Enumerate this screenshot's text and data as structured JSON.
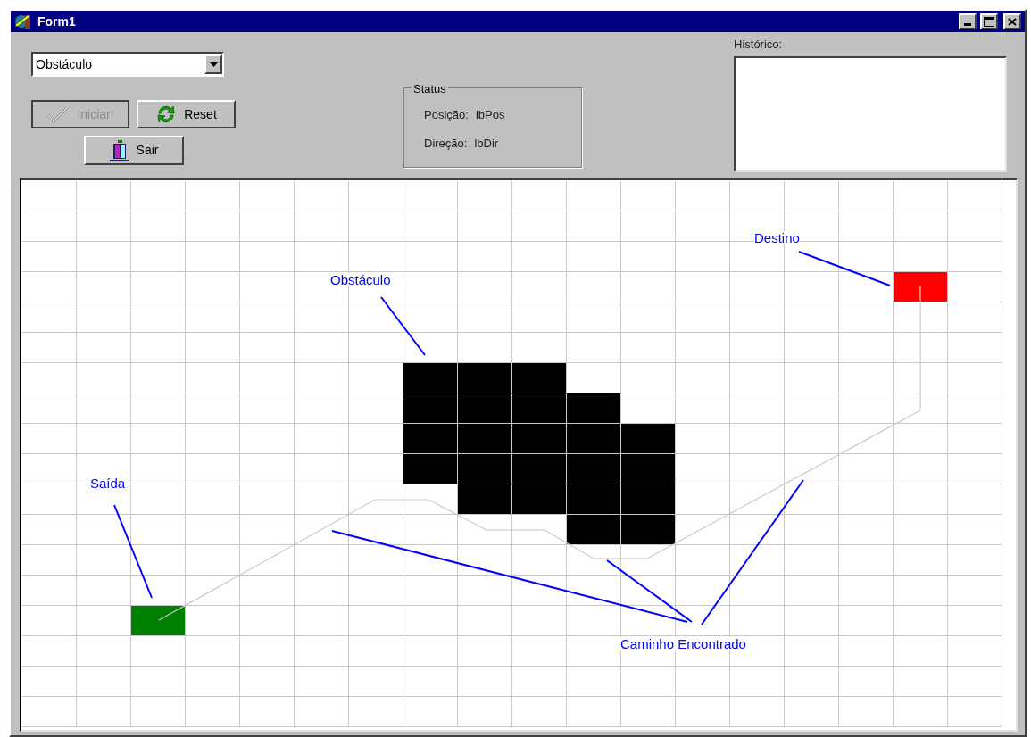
{
  "window": {
    "title": "Form1"
  },
  "mode_select": {
    "value": "Obstáculo"
  },
  "buttons": [
    {
      "label": "Iniciar!",
      "kind": "start",
      "disabled": true
    },
    {
      "label": "Reset",
      "kind": "reset",
      "disabled": false
    },
    {
      "label": "Sair",
      "kind": "exit",
      "disabled": false
    }
  ],
  "status": {
    "title": "Status",
    "rows": [
      {
        "label": "Posição:",
        "value": "lbPos"
      },
      {
        "label": "Direção:",
        "value": "lbDir"
      }
    ]
  },
  "history": {
    "label": "Histórico:"
  },
  "grid": {
    "rows": [
      {
        "cells": [
          {
            "kind": "empty"
          },
          {
            "kind": "empty"
          },
          {
            "kind": "empty"
          },
          {
            "kind": "empty"
          },
          {
            "kind": "empty"
          },
          {
            "kind": "empty"
          },
          {
            "kind": "empty"
          },
          {
            "kind": "empty"
          },
          {
            "kind": "empty"
          },
          {
            "kind": "empty"
          },
          {
            "kind": "empty"
          },
          {
            "kind": "empty"
          },
          {
            "kind": "empty"
          },
          {
            "kind": "empty"
          },
          {
            "kind": "empty"
          },
          {
            "kind": "empty"
          },
          {
            "kind": "empty"
          },
          {
            "kind": "empty"
          }
        ]
      },
      {
        "cells": [
          {
            "kind": "empty"
          },
          {
            "kind": "empty"
          },
          {
            "kind": "empty"
          },
          {
            "kind": "empty"
          },
          {
            "kind": "empty"
          },
          {
            "kind": "empty"
          },
          {
            "kind": "empty"
          },
          {
            "kind": "empty"
          },
          {
            "kind": "empty"
          },
          {
            "kind": "empty"
          },
          {
            "kind": "empty"
          },
          {
            "kind": "empty"
          },
          {
            "kind": "empty"
          },
          {
            "kind": "empty"
          },
          {
            "kind": "empty"
          },
          {
            "kind": "empty"
          },
          {
            "kind": "empty"
          },
          {
            "kind": "empty"
          }
        ]
      },
      {
        "cells": [
          {
            "kind": "empty"
          },
          {
            "kind": "empty"
          },
          {
            "kind": "empty"
          },
          {
            "kind": "empty"
          },
          {
            "kind": "empty"
          },
          {
            "kind": "empty"
          },
          {
            "kind": "empty"
          },
          {
            "kind": "empty"
          },
          {
            "kind": "empty"
          },
          {
            "kind": "empty"
          },
          {
            "kind": "empty"
          },
          {
            "kind": "empty"
          },
          {
            "kind": "empty"
          },
          {
            "kind": "empty"
          },
          {
            "kind": "empty"
          },
          {
            "kind": "empty"
          },
          {
            "kind": "empty"
          },
          {
            "kind": "empty"
          }
        ]
      },
      {
        "cells": [
          {
            "kind": "empty"
          },
          {
            "kind": "empty"
          },
          {
            "kind": "empty"
          },
          {
            "kind": "empty"
          },
          {
            "kind": "empty"
          },
          {
            "kind": "empty"
          },
          {
            "kind": "empty"
          },
          {
            "kind": "empty"
          },
          {
            "kind": "empty"
          },
          {
            "kind": "empty"
          },
          {
            "kind": "empty"
          },
          {
            "kind": "empty"
          },
          {
            "kind": "empty"
          },
          {
            "kind": "empty"
          },
          {
            "kind": "empty"
          },
          {
            "kind": "empty"
          },
          {
            "kind": "goal"
          },
          {
            "kind": "empty"
          }
        ]
      },
      {
        "cells": [
          {
            "kind": "empty"
          },
          {
            "kind": "empty"
          },
          {
            "kind": "empty"
          },
          {
            "kind": "empty"
          },
          {
            "kind": "empty"
          },
          {
            "kind": "empty"
          },
          {
            "kind": "empty"
          },
          {
            "kind": "empty"
          },
          {
            "kind": "empty"
          },
          {
            "kind": "empty"
          },
          {
            "kind": "empty"
          },
          {
            "kind": "empty"
          },
          {
            "kind": "empty"
          },
          {
            "kind": "empty"
          },
          {
            "kind": "empty"
          },
          {
            "kind": "empty"
          },
          {
            "kind": "empty"
          },
          {
            "kind": "empty"
          }
        ]
      },
      {
        "cells": [
          {
            "kind": "empty"
          },
          {
            "kind": "empty"
          },
          {
            "kind": "empty"
          },
          {
            "kind": "empty"
          },
          {
            "kind": "empty"
          },
          {
            "kind": "empty"
          },
          {
            "kind": "empty"
          },
          {
            "kind": "empty"
          },
          {
            "kind": "empty"
          },
          {
            "kind": "empty"
          },
          {
            "kind": "empty"
          },
          {
            "kind": "empty"
          },
          {
            "kind": "empty"
          },
          {
            "kind": "empty"
          },
          {
            "kind": "empty"
          },
          {
            "kind": "empty"
          },
          {
            "kind": "empty"
          },
          {
            "kind": "empty"
          }
        ]
      },
      {
        "cells": [
          {
            "kind": "empty"
          },
          {
            "kind": "empty"
          },
          {
            "kind": "empty"
          },
          {
            "kind": "empty"
          },
          {
            "kind": "empty"
          },
          {
            "kind": "empty"
          },
          {
            "kind": "empty"
          },
          {
            "kind": "obstacle"
          },
          {
            "kind": "obstacle"
          },
          {
            "kind": "obstacle"
          },
          {
            "kind": "empty"
          },
          {
            "kind": "empty"
          },
          {
            "kind": "empty"
          },
          {
            "kind": "empty"
          },
          {
            "kind": "empty"
          },
          {
            "kind": "empty"
          },
          {
            "kind": "empty"
          },
          {
            "kind": "empty"
          }
        ]
      },
      {
        "cells": [
          {
            "kind": "empty"
          },
          {
            "kind": "empty"
          },
          {
            "kind": "empty"
          },
          {
            "kind": "empty"
          },
          {
            "kind": "empty"
          },
          {
            "kind": "empty"
          },
          {
            "kind": "empty"
          },
          {
            "kind": "obstacle"
          },
          {
            "kind": "obstacle"
          },
          {
            "kind": "obstacle"
          },
          {
            "kind": "obstacle"
          },
          {
            "kind": "empty"
          },
          {
            "kind": "empty"
          },
          {
            "kind": "empty"
          },
          {
            "kind": "empty"
          },
          {
            "kind": "empty"
          },
          {
            "kind": "empty"
          },
          {
            "kind": "empty"
          }
        ]
      },
      {
        "cells": [
          {
            "kind": "empty"
          },
          {
            "kind": "empty"
          },
          {
            "kind": "empty"
          },
          {
            "kind": "empty"
          },
          {
            "kind": "empty"
          },
          {
            "kind": "empty"
          },
          {
            "kind": "empty"
          },
          {
            "kind": "obstacle"
          },
          {
            "kind": "obstacle"
          },
          {
            "kind": "obstacle"
          },
          {
            "kind": "obstacle"
          },
          {
            "kind": "obstacle"
          },
          {
            "kind": "empty"
          },
          {
            "kind": "empty"
          },
          {
            "kind": "empty"
          },
          {
            "kind": "empty"
          },
          {
            "kind": "empty"
          },
          {
            "kind": "empty"
          }
        ]
      },
      {
        "cells": [
          {
            "kind": "empty"
          },
          {
            "kind": "empty"
          },
          {
            "kind": "empty"
          },
          {
            "kind": "empty"
          },
          {
            "kind": "empty"
          },
          {
            "kind": "empty"
          },
          {
            "kind": "empty"
          },
          {
            "kind": "obstacle"
          },
          {
            "kind": "obstacle"
          },
          {
            "kind": "obstacle"
          },
          {
            "kind": "obstacle"
          },
          {
            "kind": "obstacle"
          },
          {
            "kind": "empty"
          },
          {
            "kind": "empty"
          },
          {
            "kind": "empty"
          },
          {
            "kind": "empty"
          },
          {
            "kind": "empty"
          },
          {
            "kind": "empty"
          }
        ]
      },
      {
        "cells": [
          {
            "kind": "empty"
          },
          {
            "kind": "empty"
          },
          {
            "kind": "empty"
          },
          {
            "kind": "empty"
          },
          {
            "kind": "empty"
          },
          {
            "kind": "empty"
          },
          {
            "kind": "empty"
          },
          {
            "kind": "empty"
          },
          {
            "kind": "obstacle"
          },
          {
            "kind": "obstacle"
          },
          {
            "kind": "obstacle"
          },
          {
            "kind": "obstacle"
          },
          {
            "kind": "empty"
          },
          {
            "kind": "empty"
          },
          {
            "kind": "empty"
          },
          {
            "kind": "empty"
          },
          {
            "kind": "empty"
          },
          {
            "kind": "empty"
          }
        ]
      },
      {
        "cells": [
          {
            "kind": "empty"
          },
          {
            "kind": "empty"
          },
          {
            "kind": "empty"
          },
          {
            "kind": "empty"
          },
          {
            "kind": "empty"
          },
          {
            "kind": "empty"
          },
          {
            "kind": "empty"
          },
          {
            "kind": "empty"
          },
          {
            "kind": "empty"
          },
          {
            "kind": "empty"
          },
          {
            "kind": "obstacle"
          },
          {
            "kind": "obstacle"
          },
          {
            "kind": "empty"
          },
          {
            "kind": "empty"
          },
          {
            "kind": "empty"
          },
          {
            "kind": "empty"
          },
          {
            "kind": "empty"
          },
          {
            "kind": "empty"
          }
        ]
      },
      {
        "cells": [
          {
            "kind": "empty"
          },
          {
            "kind": "empty"
          },
          {
            "kind": "empty"
          },
          {
            "kind": "empty"
          },
          {
            "kind": "empty"
          },
          {
            "kind": "empty"
          },
          {
            "kind": "empty"
          },
          {
            "kind": "empty"
          },
          {
            "kind": "empty"
          },
          {
            "kind": "empty"
          },
          {
            "kind": "empty"
          },
          {
            "kind": "empty"
          },
          {
            "kind": "empty"
          },
          {
            "kind": "empty"
          },
          {
            "kind": "empty"
          },
          {
            "kind": "empty"
          },
          {
            "kind": "empty"
          },
          {
            "kind": "empty"
          }
        ]
      },
      {
        "cells": [
          {
            "kind": "empty"
          },
          {
            "kind": "empty"
          },
          {
            "kind": "empty"
          },
          {
            "kind": "empty"
          },
          {
            "kind": "empty"
          },
          {
            "kind": "empty"
          },
          {
            "kind": "empty"
          },
          {
            "kind": "empty"
          },
          {
            "kind": "empty"
          },
          {
            "kind": "empty"
          },
          {
            "kind": "empty"
          },
          {
            "kind": "empty"
          },
          {
            "kind": "empty"
          },
          {
            "kind": "empty"
          },
          {
            "kind": "empty"
          },
          {
            "kind": "empty"
          },
          {
            "kind": "empty"
          },
          {
            "kind": "empty"
          }
        ]
      },
      {
        "cells": [
          {
            "kind": "empty"
          },
          {
            "kind": "empty"
          },
          {
            "kind": "start"
          },
          {
            "kind": "empty"
          },
          {
            "kind": "empty"
          },
          {
            "kind": "empty"
          },
          {
            "kind": "empty"
          },
          {
            "kind": "empty"
          },
          {
            "kind": "empty"
          },
          {
            "kind": "empty"
          },
          {
            "kind": "empty"
          },
          {
            "kind": "empty"
          },
          {
            "kind": "empty"
          },
          {
            "kind": "empty"
          },
          {
            "kind": "empty"
          },
          {
            "kind": "empty"
          },
          {
            "kind": "empty"
          },
          {
            "kind": "empty"
          }
        ]
      },
      {
        "cells": [
          {
            "kind": "empty"
          },
          {
            "kind": "empty"
          },
          {
            "kind": "empty"
          },
          {
            "kind": "empty"
          },
          {
            "kind": "empty"
          },
          {
            "kind": "empty"
          },
          {
            "kind": "empty"
          },
          {
            "kind": "empty"
          },
          {
            "kind": "empty"
          },
          {
            "kind": "empty"
          },
          {
            "kind": "empty"
          },
          {
            "kind": "empty"
          },
          {
            "kind": "empty"
          },
          {
            "kind": "empty"
          },
          {
            "kind": "empty"
          },
          {
            "kind": "empty"
          },
          {
            "kind": "empty"
          },
          {
            "kind": "empty"
          }
        ]
      },
      {
        "cells": [
          {
            "kind": "empty"
          },
          {
            "kind": "empty"
          },
          {
            "kind": "empty"
          },
          {
            "kind": "empty"
          },
          {
            "kind": "empty"
          },
          {
            "kind": "empty"
          },
          {
            "kind": "empty"
          },
          {
            "kind": "empty"
          },
          {
            "kind": "empty"
          },
          {
            "kind": "empty"
          },
          {
            "kind": "empty"
          },
          {
            "kind": "empty"
          },
          {
            "kind": "empty"
          },
          {
            "kind": "empty"
          },
          {
            "kind": "empty"
          },
          {
            "kind": "empty"
          },
          {
            "kind": "empty"
          },
          {
            "kind": "empty"
          }
        ]
      },
      {
        "cells": [
          {
            "kind": "empty"
          },
          {
            "kind": "empty"
          },
          {
            "kind": "empty"
          },
          {
            "kind": "empty"
          },
          {
            "kind": "empty"
          },
          {
            "kind": "empty"
          },
          {
            "kind": "empty"
          },
          {
            "kind": "empty"
          },
          {
            "kind": "empty"
          },
          {
            "kind": "empty"
          },
          {
            "kind": "empty"
          },
          {
            "kind": "empty"
          },
          {
            "kind": "empty"
          },
          {
            "kind": "empty"
          },
          {
            "kind": "empty"
          },
          {
            "kind": "empty"
          },
          {
            "kind": "empty"
          },
          {
            "kind": "empty"
          }
        ]
      }
    ]
  },
  "annotations": [
    {
      "kind": "obstacle",
      "text": "Obstáculo"
    },
    {
      "kind": "goal",
      "text": "Destino"
    },
    {
      "kind": "start",
      "text": "Saída"
    },
    {
      "kind": "path",
      "text": "Caminho Encontrado"
    }
  ]
}
